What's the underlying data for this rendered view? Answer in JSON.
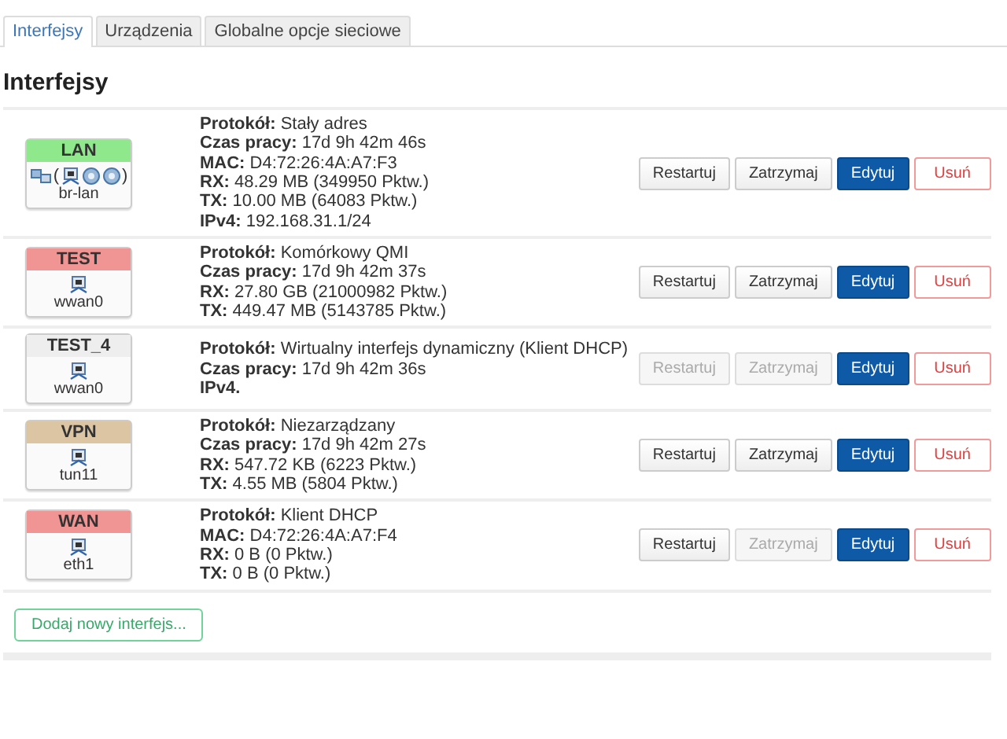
{
  "tabs": [
    {
      "label": "Interfejsy",
      "selected": true
    },
    {
      "label": "Urządzenia",
      "selected": false
    },
    {
      "label": "Globalne opcje sieciowe",
      "selected": false
    }
  ],
  "heading": "Interfejsy",
  "interfaces": [
    {
      "name": "LAN",
      "color": "#90e88c",
      "device": "br-lan",
      "kind": "bridge",
      "members": {
        "open": "(",
        "close": ")",
        "items": [
          {
            "kind": "ethernet"
          },
          {
            "kind": "wifi"
          },
          {
            "kind": "wifi"
          }
        ]
      },
      "details": [
        {
          "label": "Protokół:",
          "value": "Stały adres"
        },
        {
          "label": "Czas pracy:",
          "value": "17d 9h 42m 46s"
        },
        {
          "label": "MAC:",
          "value": "D4:72:26:4A:A7:F3"
        },
        {
          "label": "RX:",
          "value": "48.29 MB (349950 Pktw.)"
        },
        {
          "label": "TX:",
          "value": "10.00 MB (64083 Pktw.)"
        },
        {
          "label": "IPv4:",
          "value": "192.168.31.1/24"
        }
      ],
      "buttons": [
        {
          "label": "Restartuj",
          "kind": "default",
          "disabled": false
        },
        {
          "label": "Zatrzymaj",
          "kind": "default",
          "disabled": false
        },
        {
          "label": "Edytuj",
          "kind": "primary",
          "disabled": false
        },
        {
          "label": "Usuń",
          "kind": "danger",
          "disabled": false
        }
      ]
    },
    {
      "name": "TEST",
      "color": "#f09494",
      "device": "wwan0",
      "kind": "ethernet",
      "details": [
        {
          "label": "Protokół:",
          "value": "Komórkowy QMI"
        },
        {
          "label": "Czas pracy:",
          "value": "17d 9h 42m 37s"
        },
        {
          "label": "RX:",
          "value": "27.80 GB (21000982 Pktw.)"
        },
        {
          "label": "TX:",
          "value": "449.47 MB (5143785 Pktw.)"
        }
      ],
      "buttons": [
        {
          "label": "Restartuj",
          "kind": "default",
          "disabled": false
        },
        {
          "label": "Zatrzymaj",
          "kind": "default",
          "disabled": false
        },
        {
          "label": "Edytuj",
          "kind": "primary",
          "disabled": false
        },
        {
          "label": "Usuń",
          "kind": "danger",
          "disabled": false
        }
      ]
    },
    {
      "name": "TEST_4",
      "color": "#eeeeee",
      "device": "wwan0",
      "kind": "ethernet",
      "details": [
        {
          "label": "Protokół:",
          "value": "Wirtualny interfejs dynamiczny (Klient DHCP)"
        },
        {
          "label": "Czas pracy:",
          "value": "17d 9h 42m 36s"
        },
        {
          "label": "IPv4."
        }
      ],
      "buttons": [
        {
          "label": "Restartuj",
          "kind": "default",
          "disabled": true
        },
        {
          "label": "Zatrzymaj",
          "kind": "default",
          "disabled": true
        },
        {
          "label": "Edytuj",
          "kind": "primary",
          "disabled": false
        },
        {
          "label": "Usuń",
          "kind": "danger",
          "disabled": false
        }
      ]
    },
    {
      "name": "VPN",
      "color": "#dcc5a2",
      "device": "tun11",
      "kind": "ethernet",
      "details": [
        {
          "label": "Protokół:",
          "value": "Niezarządzany"
        },
        {
          "label": "Czas pracy:",
          "value": "17d 9h 42m 27s"
        },
        {
          "label": "RX:",
          "value": "547.72 KB (6223 Pktw.)"
        },
        {
          "label": "TX:",
          "value": "4.55 MB (5804 Pktw.)"
        }
      ],
      "buttons": [
        {
          "label": "Restartuj",
          "kind": "default",
          "disabled": false
        },
        {
          "label": "Zatrzymaj",
          "kind": "default",
          "disabled": false
        },
        {
          "label": "Edytuj",
          "kind": "primary",
          "disabled": false
        },
        {
          "label": "Usuń",
          "kind": "danger",
          "disabled": false
        }
      ]
    },
    {
      "name": "WAN",
      "color": "#f09494",
      "device": "eth1",
      "kind": "ethernet",
      "details": [
        {
          "label": "Protokół:",
          "value": "Klient DHCP"
        },
        {
          "label": "MAC:",
          "value": "D4:72:26:4A:A7:F4"
        },
        {
          "label": "RX:",
          "value": "0 B (0 Pktw.)"
        },
        {
          "label": "TX:",
          "value": "0 B (0 Pktw.)"
        }
      ],
      "buttons": [
        {
          "label": "Restartuj",
          "kind": "default",
          "disabled": false
        },
        {
          "label": "Zatrzymaj",
          "kind": "default",
          "disabled": true
        },
        {
          "label": "Edytuj",
          "kind": "primary",
          "disabled": false
        },
        {
          "label": "Usuń",
          "kind": "danger",
          "disabled": false
        }
      ]
    }
  ],
  "add_button": "Dodaj nowy interfejs..."
}
